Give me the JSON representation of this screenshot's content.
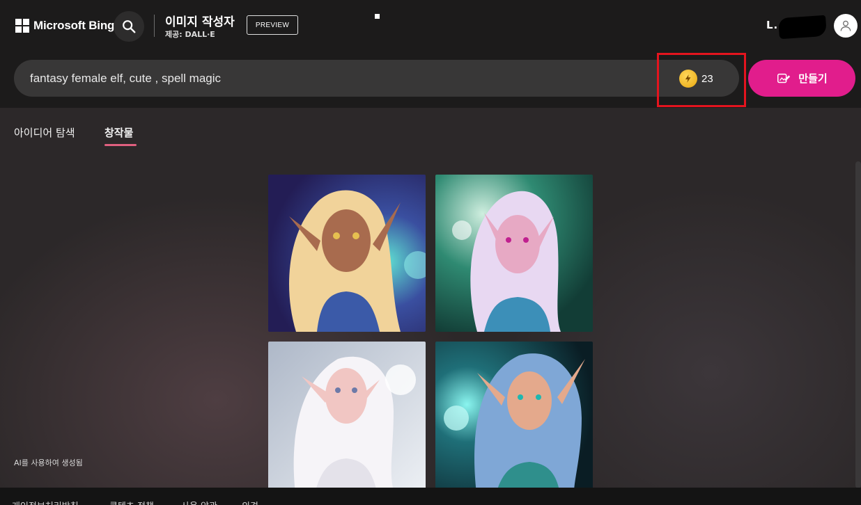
{
  "header": {
    "brand": "Microsoft Bing",
    "app_title": "이미지 작성자",
    "app_subtitle": "제공: DALL·E",
    "preview_label": "PREVIEW",
    "user_name": "L.....N"
  },
  "search": {
    "value": "fantasy female elf, cute , spell magic",
    "placeholder": "",
    "boost_count": "23",
    "create_label": "만들기"
  },
  "tabs": [
    {
      "label": "아이디어 탐색",
      "active": false
    },
    {
      "label": "창작물",
      "active": true
    }
  ],
  "gallery": {
    "images": [
      {
        "name": "elf-1",
        "hair": "#f3d59a",
        "bg1": "#2b2a6b",
        "bg2": "#3aa6b0",
        "skin": "#a86b4e",
        "dress": "#3b5aa8"
      },
      {
        "name": "elf-2",
        "hair": "#e7d7f2",
        "bg1": "#1e6a5a",
        "bg2": "#9fd7c2",
        "skin": "#e7a9c4",
        "dress": "#3c8fb8"
      },
      {
        "name": "elf-3",
        "hair": "#f4f2f6",
        "bg1": "#b9c3cf",
        "bg2": "#e7ebf0",
        "skin": "#f1c6c3",
        "dress": "#e4e2ea"
      },
      {
        "name": "elf-4",
        "hair": "#7fa7d6",
        "bg1": "#0d2a33",
        "bg2": "#2ec1c0",
        "skin": "#e4a98c",
        "dress": "#2f8f8c"
      }
    ]
  },
  "ai_note": "AI를 사용하여 생성됨",
  "footer": {
    "links": [
      "개인정보처리방침",
      "콘텐츠 정책",
      "사용 약관",
      "의견"
    ]
  },
  "colors": {
    "accent": "#e11d8c",
    "highlight": "#e4141e",
    "tab_underline": "#e0607f"
  }
}
